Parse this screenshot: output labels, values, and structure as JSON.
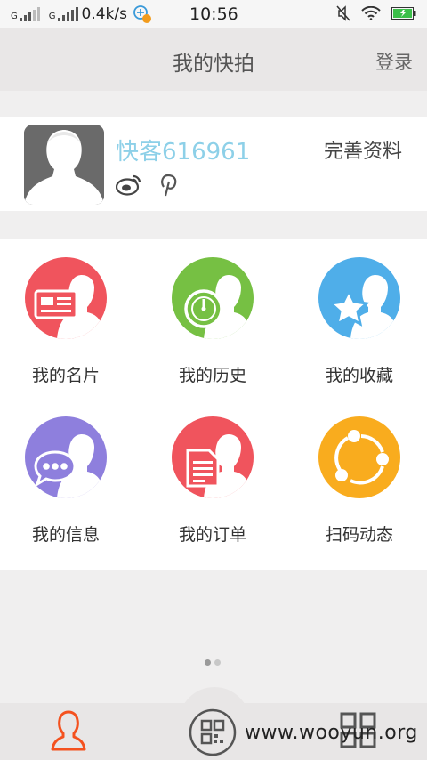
{
  "status_bar": {
    "network_1": "G",
    "network_2": "G",
    "speed": "0.4k/s",
    "time": "10:56"
  },
  "header": {
    "title": "我的快拍",
    "login": "登录"
  },
  "profile": {
    "username": "快客616961",
    "complete": "完善资料"
  },
  "menu": [
    {
      "label": "我的名片",
      "color": "#f0545d",
      "icon": "business-card-icon"
    },
    {
      "label": "我的历史",
      "color": "#76c043",
      "icon": "clock-icon"
    },
    {
      "label": "我的收藏",
      "color": "#4faee9",
      "icon": "star-icon"
    },
    {
      "label": "我的信息",
      "color": "#8e7fdd",
      "icon": "chat-bubble-icon"
    },
    {
      "label": "我的订单",
      "color": "#f0545d",
      "icon": "document-icon"
    },
    {
      "label": "扫码动态",
      "color": "#f9ac1e",
      "icon": "share-icon"
    }
  ],
  "watermark": "www.wooyun.org"
}
